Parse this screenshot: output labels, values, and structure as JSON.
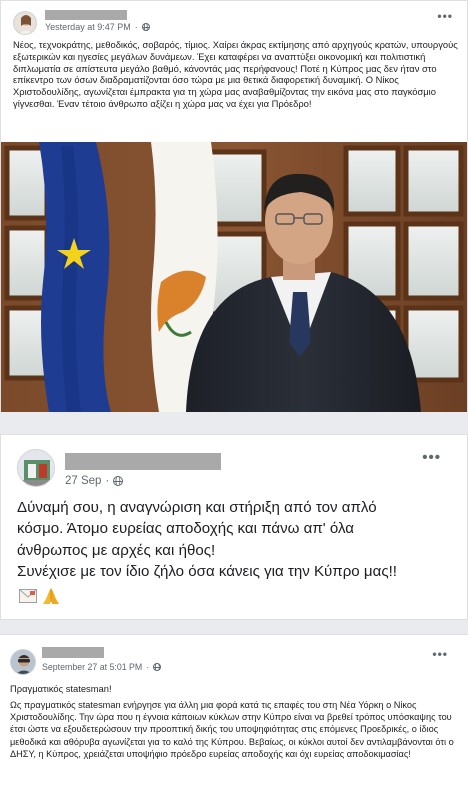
{
  "posts": [
    {
      "timestamp": "Yesterday at 9:47 PM",
      "dot": "·",
      "more": "•••",
      "text": "Νέος, τεχνοκράτης, μεθοδικός, σοβαρός, τίμιος. Χαίρει άκρας εκτίμησης από αρχηγούς κρατών, υπουργούς εξωτερικών και ηγεσίες μεγάλων δυνάμεων. Έχει καταφέρει να αναπτύξει οικονομική και πολιτιστική διπλωματία σε απίστευτα μεγάλο βαθμό, κάνοντάς μας περήφανους! Ποτέ η Κύπρος μας δεν ήταν στο επίκεντρο των όσων διαδραματίζονται όσο τώρα με μια θετικά διαφορετική δυναμική. Ο Νίκος Χριστοδουλίδης, αγωνίζεται έμπρακτα για τη χώρα μας αναβαθμίζοντας την εικόνα μας στο παγκόσμιο γίγνεσθαι. Έναν τέτοιο άνθρωπο αξίζει η χώρα μας να έχει για Πρόεδρο!"
    },
    {
      "timestamp": "27 Sep",
      "dot": "·",
      "more": "•••",
      "lines": [
        "Δύναμή σου, η αναγνώριση και στήριξη από τον απλό",
        "κόσμο. Άτομο ευρείας αποδοχής και πάνω απ' όλα",
        "άνθρωπος με αρχές και ήθος!",
        "Συνέχισε με τον ίδιο ζήλο όσα κάνεις για την Κύπρο μας!!"
      ],
      "emojis": [
        "envelope",
        "folded-hands"
      ]
    },
    {
      "timestamp": "September 27 at 5:01 PM",
      "dot": "·",
      "more": "•••",
      "heading": "Πραγματικός statesman!",
      "text": "Ως πραγματικός statesman ενήργησε για άλλη μια φορά κατά τις επαφές του στη Νέα Υόρκη ο Νίκος Χριστοδουλίδης. Την ώρα που η έγνοια κάποιων κύκλων στην Κύπρο είναι να βρεθεί τρόπος υπόσκαψης του έτσι ώστε να εξουδετερώσουν την προοπτική δικής του υποψηφιότητας στις επόμενες Προεδρικές, ο ίδιος μεθοδικά και αθόρυβα αγωνίζεται για το καλό της Κύπρου. Βεβαίως, οι κύκλοι αυτοί δεν αντιλαμβάνονται ότι ο ΔΗΣΥ, η Κύπρος, χρειάζεται υποψήφιο πρόεδρο ευρείας αποδοχής και όχι ευρείας αποδοκιμασίας!"
    }
  ],
  "colors": {
    "meta": "#606770",
    "redaction": "#a9a9a9",
    "eu_blue": "#1f3c93",
    "eu_star": "#f2d21b",
    "cyprus_orange": "#d9822b"
  }
}
